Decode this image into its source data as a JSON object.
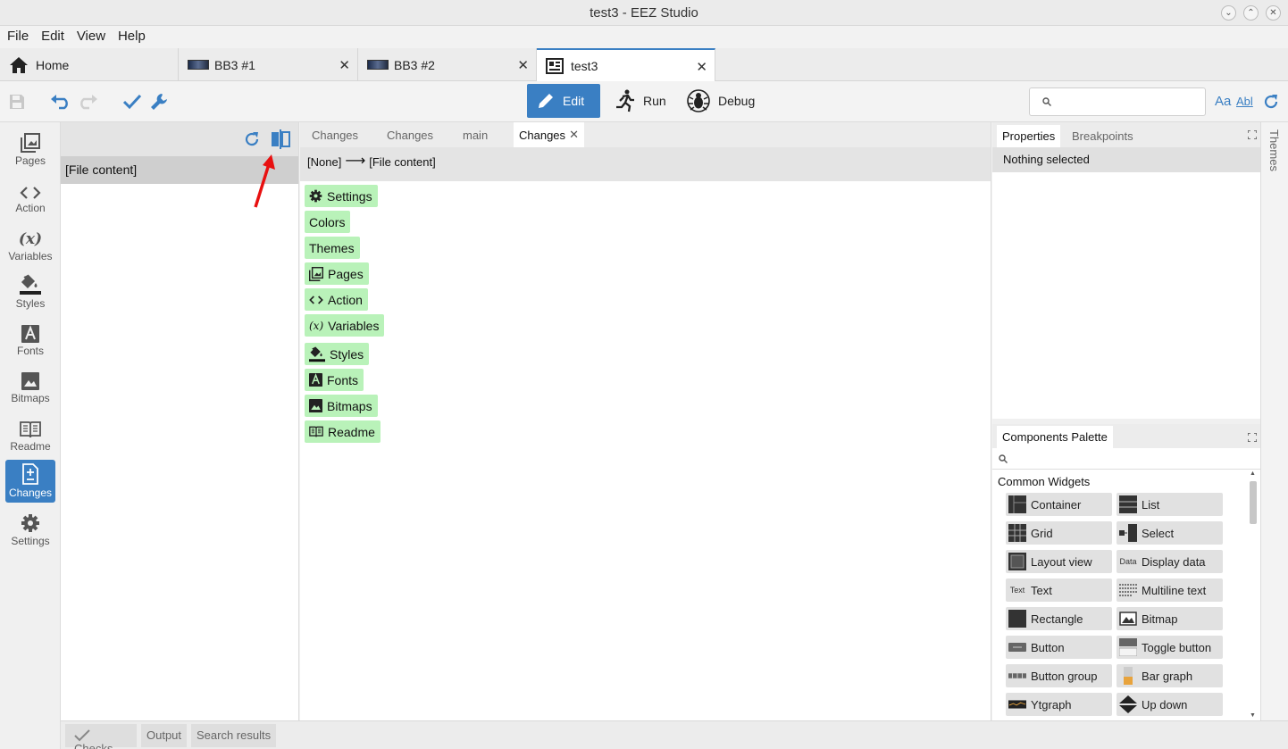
{
  "window": {
    "title": "test3 - EEZ Studio"
  },
  "menu": [
    "File",
    "Edit",
    "View",
    "Help"
  ],
  "tabs": [
    {
      "label": "Home"
    },
    {
      "label": "BB3 #1"
    },
    {
      "label": "BB3 #2"
    },
    {
      "label": "test3"
    }
  ],
  "modes": {
    "edit": "Edit",
    "run": "Run",
    "debug": "Debug"
  },
  "search": {
    "placeholder": "",
    "match_case": "Aa",
    "whole_word": "Abl"
  },
  "sidebar": [
    {
      "label": "Pages"
    },
    {
      "label": "Action"
    },
    {
      "label": "Variables"
    },
    {
      "label": "Styles"
    },
    {
      "label": "Fonts"
    },
    {
      "label": "Bitmaps"
    },
    {
      "label": "Readme"
    },
    {
      "label": "Changes"
    },
    {
      "label": "Settings"
    }
  ],
  "left_panel": {
    "row": "[File content]"
  },
  "editor_tabs": [
    "Changes",
    "Changes",
    "main",
    "Changes"
  ],
  "breadcrumb": {
    "from": "[None]",
    "arrow": "⟶",
    "to": "[File content]"
  },
  "changes": [
    "Settings",
    "Colors",
    "Themes",
    "Pages",
    "Action",
    "Variables",
    "Styles",
    "Fonts",
    "Bitmaps",
    "Readme"
  ],
  "properties": {
    "tabs": [
      "Properties",
      "Breakpoints"
    ],
    "empty": "Nothing selected"
  },
  "palette": {
    "title": "Components Palette",
    "group": "Common Widgets",
    "widgets": [
      "Container",
      "List",
      "Grid",
      "Select",
      "Layout view",
      "Display data",
      "Text",
      "Multiline text",
      "Rectangle",
      "Bitmap",
      "Button",
      "Toggle button",
      "Button group",
      "Bar graph",
      "Ytgraph",
      "Up down"
    ],
    "icon_texts": {
      "text": "Text",
      "data": "Data"
    }
  },
  "themes_bar": "Themes",
  "bottom_tabs": [
    "Checks",
    "Output",
    "Search results"
  ],
  "colors": {
    "accent": "#3a7fc3",
    "change_chip": "#b9f2b9",
    "annotation_arrow": "#e81010"
  }
}
